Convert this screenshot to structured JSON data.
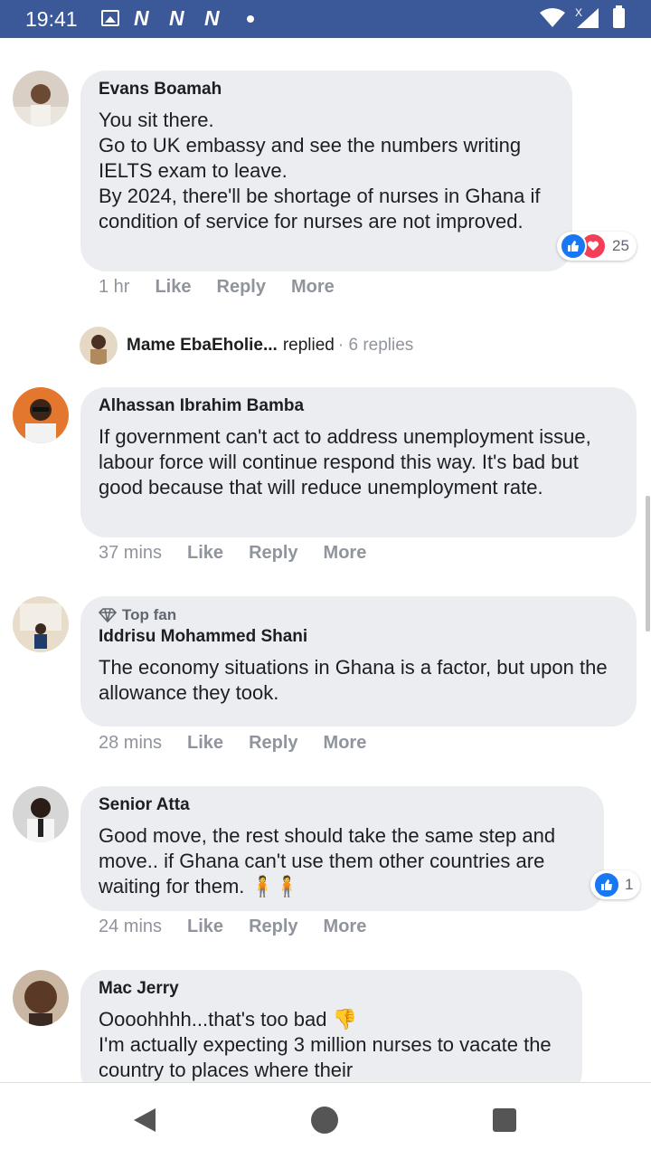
{
  "status_bar": {
    "time": "19:41",
    "app_icons": [
      "N",
      "N",
      "N"
    ],
    "signal_badge": "X"
  },
  "comments": [
    {
      "author": "Evans Boamah",
      "text": "You sit there.\nGo to UK embassy and see the numbers writing IELTS exam to leave.\nBy 2024, there'll be shortage of nurses in Ghana if condition of service for nurses are not improved.",
      "time": "1 hr",
      "reaction_count": "25",
      "reactions": [
        "like-icon",
        "love-icon"
      ]
    },
    {
      "author": "Alhassan Ibrahim Bamba",
      "text": "If government can't act to address unemployment issue, labour force will continue respond this way. It's bad but good because that will reduce unemployment rate.",
      "time": "37 mins"
    },
    {
      "badge": "Top fan",
      "author": "Iddrisu Mohammed Shani",
      "text": "The economy situations in Ghana is a factor, but upon the allowance they took.",
      "time": "28 mins"
    },
    {
      "author": "Senior Atta",
      "text": "Good move, the rest should take the same step and move.. if Ghana can't use them other countries are waiting for them. 🧍🧍",
      "time": "24 mins",
      "reaction_count": "1",
      "reactions": [
        "like-icon"
      ]
    },
    {
      "author": "Mac Jerry",
      "text": "Oooohhhh...that's too bad 👎\nI'm actually expecting 3 million nurses to vacate the country to places where their"
    }
  ],
  "actions": {
    "like": "Like",
    "reply": "Reply",
    "more": "More"
  },
  "replied": {
    "name": "Mame EbaEholie...",
    "verb": "replied",
    "count": "· 6 replies"
  },
  "colors": {
    "status_bar": "#3b5998",
    "bubble": "#ebedf0",
    "like": "#1877f2",
    "love": "#f33e58"
  }
}
